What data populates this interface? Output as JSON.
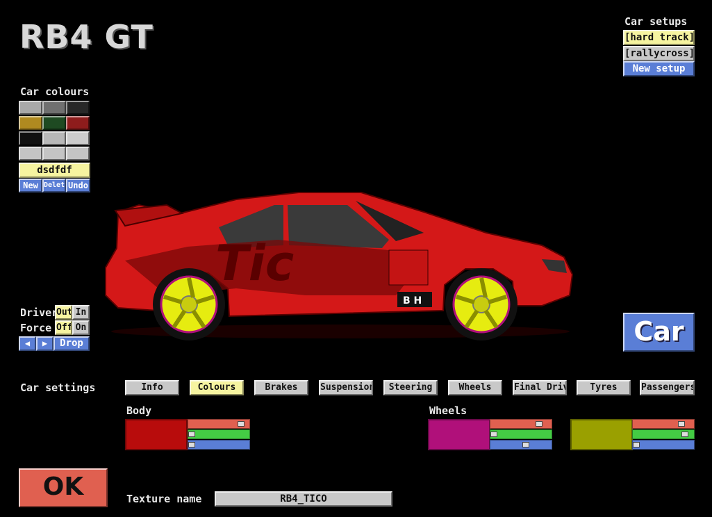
{
  "car_name": "RB4 GT",
  "car_setups": {
    "label": "Car setups",
    "items": [
      "[hard track]",
      "[rallycross]"
    ],
    "new_label": "New setup"
  },
  "car_colours": {
    "label": "Car colours",
    "swatches": [
      "#a8a8a8",
      "#707070",
      "#282828",
      "#b08a20",
      "#1e4a22",
      "#8e1c1c",
      "#101010",
      "#b8b8b8",
      "#cccccc",
      "#c4c4c4",
      "#c4c4c4",
      "#c4c4c4"
    ],
    "name": "dsdfdf",
    "new_label": "New",
    "delete_label": "Delete",
    "undo_label": "Undo"
  },
  "driver": {
    "label": "Driver",
    "out": "Out",
    "in": "In"
  },
  "force": {
    "label": "Force",
    "off": "Off",
    "on": "On"
  },
  "nav": {
    "prev": "◀",
    "next": "▶",
    "drop": "Drop"
  },
  "car_button": "Car",
  "settings": {
    "label": "Car settings",
    "tabs": [
      "Info",
      "Colours",
      "Brakes",
      "Suspension",
      "Steering",
      "Wheels",
      "Final Drive",
      "Tyres",
      "Passengers"
    ],
    "active": "Colours"
  },
  "body_colour": {
    "label": "Body",
    "color": "#b80c0c",
    "r": 0.94,
    "g": 0.0,
    "b": 0.0
  },
  "wheels_colour": {
    "label": "Wheels",
    "color": "#b0107a",
    "r": 0.85,
    "g": 0.0,
    "b": 0.6
  },
  "wheels_colour2": {
    "color": "#9aa000",
    "r": 0.85,
    "g": 0.92,
    "b": 0.0
  },
  "texture": {
    "label": "Texture name",
    "value": "RB4_TICO"
  },
  "ok_label": "OK",
  "colors": {
    "car_red": "#d41818",
    "rim_yellow": "#e6ec10"
  }
}
